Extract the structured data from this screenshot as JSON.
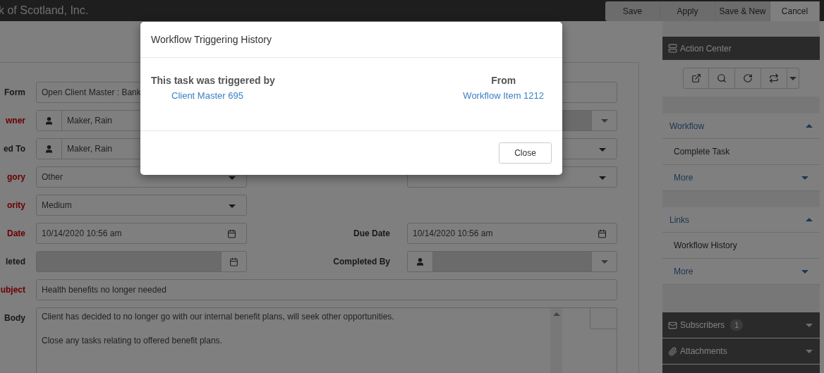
{
  "header": {
    "company": "k of Scotland, Inc.",
    "buttons": [
      {
        "label": "Save",
        "highlighted": false
      },
      {
        "label": "Apply",
        "highlighted": false
      },
      {
        "label": "Save & New",
        "highlighted": false
      },
      {
        "label": "Cancel",
        "highlighted": true
      }
    ]
  },
  "form": {
    "rows": [
      {
        "label": "Form",
        "required": false,
        "field": {
          "kind": "text",
          "value": "Open Client Master : Bank"
        },
        "right": {
          "field": {
            "kind": "text"
          }
        }
      },
      {
        "label": "wner",
        "required": true,
        "field": {
          "kind": "person",
          "value": "Maker, Rain"
        },
        "right": {
          "field": {
            "kind": "select",
            "disabled": true
          }
        }
      },
      {
        "label": "ed To",
        "required": false,
        "field": {
          "kind": "person",
          "value": "Maker, Rain"
        },
        "right": {
          "field": {
            "kind": "select",
            "disabled": false
          }
        }
      },
      {
        "label": "gory",
        "required": true,
        "field": {
          "kind": "select",
          "value": "Other"
        },
        "right": {
          "field": {
            "kind": "select",
            "disabled": false
          }
        }
      },
      {
        "label": "ority",
        "required": true,
        "field": {
          "kind": "select",
          "value": "Medium"
        }
      },
      {
        "label": "Date",
        "required": true,
        "field": {
          "kind": "date",
          "value": "10/14/2020 10:56 am",
          "disabled": false
        },
        "right": {
          "label": "Due Date",
          "required": false,
          "field": {
            "kind": "date",
            "value": "10/14/2020 10:56 am",
            "disabled": false
          }
        }
      },
      {
        "label": "leted",
        "required": false,
        "field": {
          "kind": "date",
          "disabled": true
        },
        "right": {
          "label": "Completed By",
          "required": false,
          "field": {
            "kind": "person",
            "disabled": true
          }
        }
      },
      {
        "label": "ubject",
        "required": true,
        "field": {
          "kind": "wide",
          "value": "Health benefits no longer needed"
        }
      },
      {
        "label": "Body",
        "required": false,
        "field": {
          "kind": "textarea",
          "lines": [
            "Client has decided to no longer go with our internal benefit plans, will seek other opportunities.",
            "Close any tasks relating to offered benefit plans."
          ]
        }
      }
    ]
  },
  "sidebar": {
    "title": "Action Center",
    "sections": [
      {
        "title": "Workflow",
        "expanded": true,
        "items": [
          {
            "label": "Complete Task",
            "kind": "action"
          },
          {
            "label": "More",
            "kind": "more"
          }
        ]
      },
      {
        "title": "Links",
        "expanded": true,
        "items": [
          {
            "label": "Workflow History",
            "kind": "action"
          },
          {
            "label": "More",
            "kind": "more"
          }
        ]
      }
    ],
    "panels": [
      {
        "title": "Subscribers",
        "count": "1"
      },
      {
        "title": "Attachments"
      }
    ]
  },
  "modal": {
    "title": "Workflow Triggering History",
    "trigger_label": "This task was triggered by",
    "trigger_link": "Client Master 695",
    "from_label": "From",
    "from_link": "Workflow Item 1212",
    "close": "Close"
  }
}
